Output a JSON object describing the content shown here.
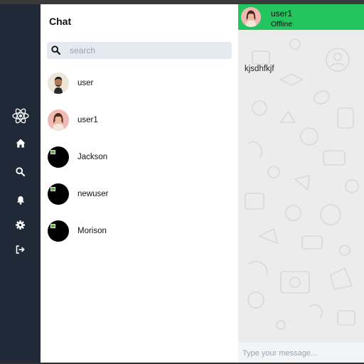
{
  "sidebar": {
    "icons": [
      "react-logo-icon",
      "home-icon",
      "search-icon",
      "bell-icon",
      "gear-icon",
      "logout-icon"
    ]
  },
  "chat_list": {
    "title": "Chat",
    "search": {
      "placeholder": "search",
      "value": ""
    },
    "contacts": [
      {
        "name": "user",
        "avatar": "man-photo"
      },
      {
        "name": "user1",
        "avatar": "woman-photo"
      },
      {
        "name": "Jackson",
        "avatar": "broken-image"
      },
      {
        "name": "newuser",
        "avatar": "broken-image"
      },
      {
        "name": "Morison",
        "avatar": "broken-image"
      }
    ]
  },
  "conversation": {
    "contact_name": "user1",
    "status": "Offline",
    "messages": [
      {
        "text": "kjsdhfkjf"
      }
    ],
    "composer": {
      "placeholder": "Type your message...",
      "value": ""
    }
  },
  "colors": {
    "rail": "#1f2937",
    "header": "#22c55e",
    "search_bg": "#e5e9f0"
  }
}
